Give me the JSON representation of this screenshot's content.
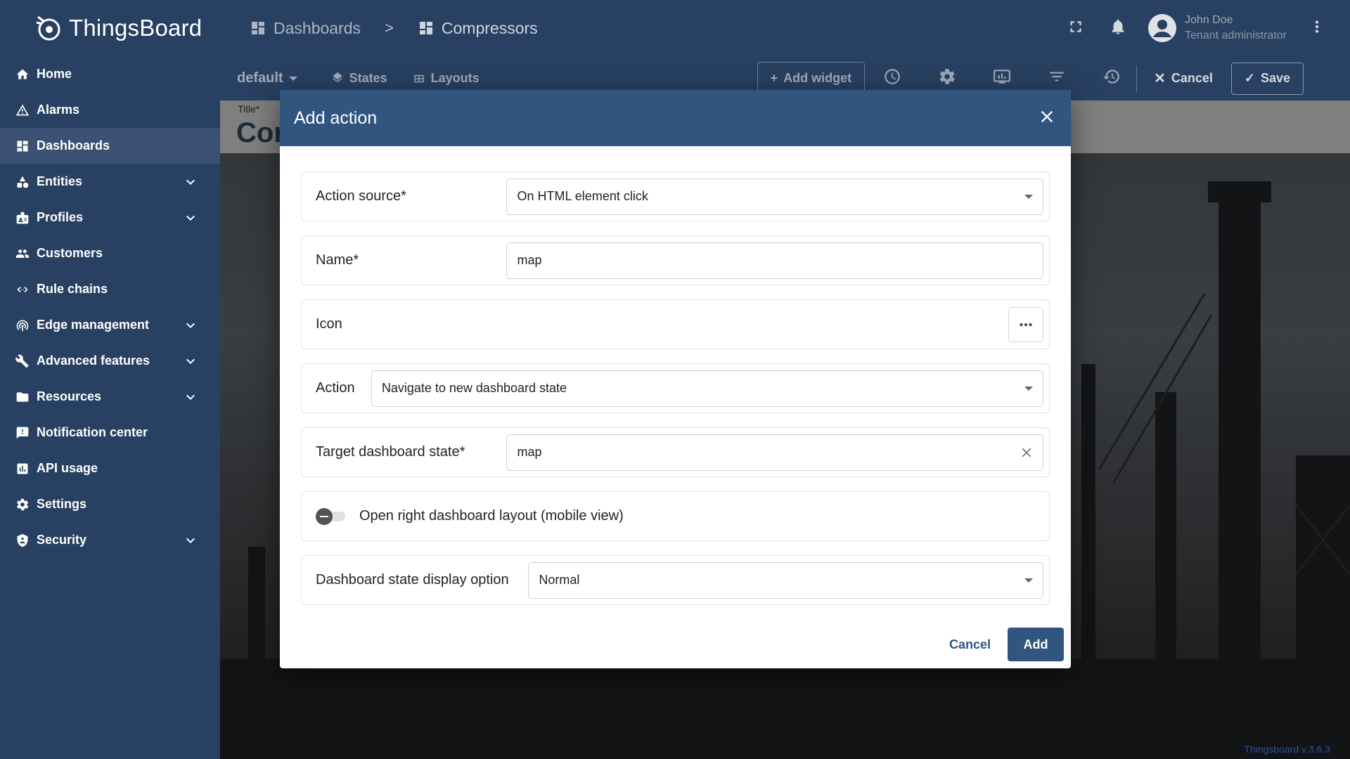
{
  "app": {
    "name": "ThingsBoard",
    "version": "Thingsboard v.3.6.3"
  },
  "sidebar": {
    "items": [
      {
        "label": "Home",
        "icon": "home-icon",
        "expandable": false
      },
      {
        "label": "Alarms",
        "icon": "alarm-icon",
        "expandable": false
      },
      {
        "label": "Dashboards",
        "icon": "dashboard-icon",
        "expandable": false,
        "active": true
      },
      {
        "label": "Entities",
        "icon": "entities-icon",
        "expandable": true
      },
      {
        "label": "Profiles",
        "icon": "profiles-icon",
        "expandable": true
      },
      {
        "label": "Customers",
        "icon": "customers-icon",
        "expandable": false
      },
      {
        "label": "Rule chains",
        "icon": "rule-chains-icon",
        "expandable": false
      },
      {
        "label": "Edge management",
        "icon": "edge-icon",
        "expandable": true
      },
      {
        "label": "Advanced features",
        "icon": "tools-icon",
        "expandable": true
      },
      {
        "label": "Resources",
        "icon": "folder-icon",
        "expandable": true
      },
      {
        "label": "Notification center",
        "icon": "notification-icon",
        "expandable": false
      },
      {
        "label": "API usage",
        "icon": "chart-icon",
        "expandable": false
      },
      {
        "label": "Settings",
        "icon": "gear-icon",
        "expandable": false
      },
      {
        "label": "Security",
        "icon": "shield-icon",
        "expandable": true
      }
    ]
  },
  "header": {
    "breadcrumb": [
      {
        "label": "Dashboards"
      },
      {
        "label": "Compressors"
      }
    ],
    "separator": ">",
    "user": {
      "name": "John Doe",
      "role": "Tenant administrator"
    }
  },
  "toolbar": {
    "state": "default",
    "states_label": "States",
    "layouts_label": "Layouts",
    "add_widget_label": "Add widget",
    "cancel_label": "Cancel",
    "save_label": "Save"
  },
  "dashboard": {
    "title_label": "Title*",
    "title_text": "Cor"
  },
  "dialog": {
    "title": "Add action",
    "action_source": {
      "label": "Action source*",
      "value": "On HTML element click"
    },
    "name": {
      "label": "Name*",
      "value": "map"
    },
    "icon": {
      "label": "Icon"
    },
    "action": {
      "label": "Action",
      "value": "Navigate to new dashboard state"
    },
    "target_state": {
      "label": "Target dashboard state*",
      "value": "map"
    },
    "open_right_layout": {
      "label": "Open right dashboard layout (mobile view)",
      "checked": false
    },
    "display_option": {
      "label": "Dashboard state display option",
      "value": "Normal"
    },
    "cancel_label": "Cancel",
    "add_label": "Add"
  },
  "colors": {
    "primary": "#305680",
    "sidebar": "#284061"
  }
}
